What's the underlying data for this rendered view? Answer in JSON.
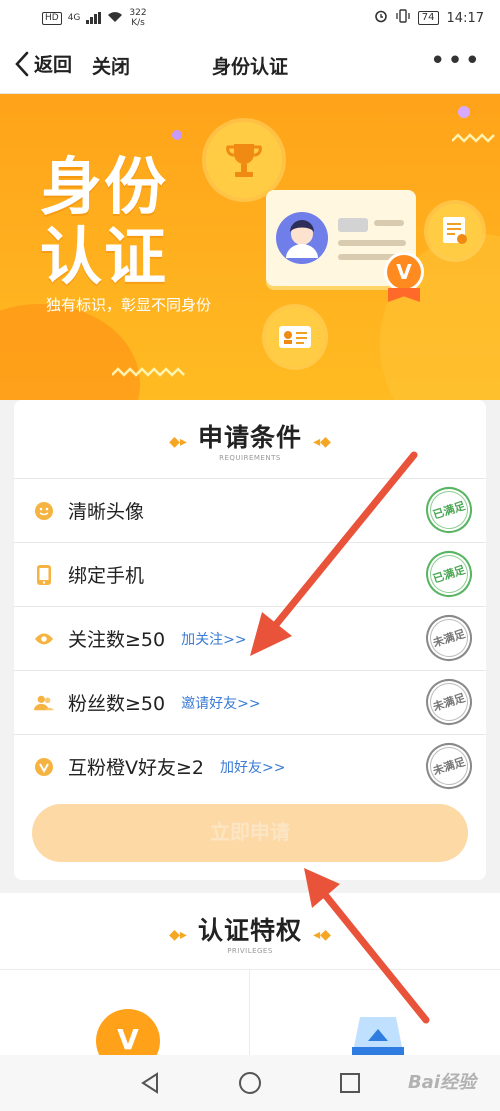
{
  "statusbar": {
    "hd": "HD",
    "net": "4G",
    "speed_value": "322",
    "speed_unit": "K/s",
    "battery": "74",
    "time": "14:17"
  },
  "nav": {
    "back_label": "返回",
    "close_label": "关闭",
    "title": "身份认证",
    "more_label": "•••"
  },
  "banner": {
    "title_line1": "身份",
    "title_line2": "认证",
    "subtitle": "独有标识，彰显不同身份"
  },
  "requirements": {
    "title": "申请条件",
    "subtitle": "REQUIREMENTS",
    "items": [
      {
        "label": "清晰头像",
        "link": "",
        "status": "已满足",
        "icon": "smile-icon",
        "met": true
      },
      {
        "label": "绑定手机",
        "link": "",
        "status": "已满足",
        "icon": "phone-icon",
        "met": true
      },
      {
        "label": "关注数≥50",
        "link": "加关注>>",
        "status": "未满足",
        "icon": "eye-icon",
        "met": false
      },
      {
        "label": "粉丝数≥50",
        "link": "邀请好友>>",
        "status": "未满足",
        "icon": "users-icon",
        "met": false
      },
      {
        "label": "互粉橙V好友≥2",
        "link": "加好友>>",
        "status": "未满足",
        "icon": "v-badge-icon",
        "met": false
      }
    ],
    "apply_button": "立即申请"
  },
  "privileges": {
    "title": "认证特权",
    "subtitle": "PRIVILEGES",
    "icon1_text": "V"
  },
  "watermark": "Bai经验",
  "colors": {
    "accent": "#ffa31a",
    "link": "#3a7bd5",
    "met": "#4aa855",
    "unmet": "#777777",
    "arrow": "#e8533a"
  }
}
